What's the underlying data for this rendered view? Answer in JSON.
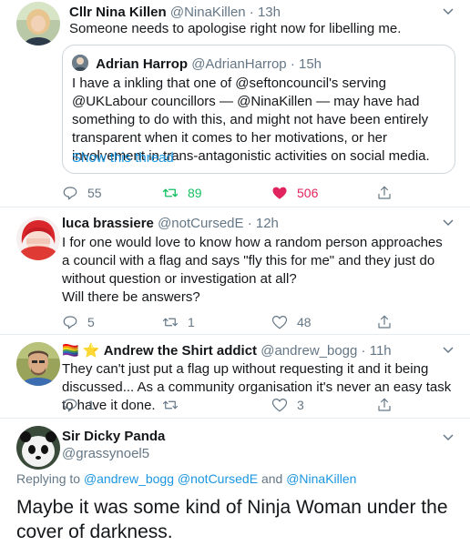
{
  "tweets": [
    {
      "name": "Cllr Nina Killen",
      "handle": "@NinaKillen",
      "time": "· 13h",
      "text": "Someone needs to apologise right now for libelling me.",
      "quote": {
        "name": "Adrian Harrop",
        "handle": "@AdrianHarrop",
        "time": "· 15h",
        "text": "I have a inkling that one of @seftoncouncil's serving @UKLabour councillors — @NinaKillen — may have had something to do with this, and might not have been entirely transparent when it comes to her motivations, or her involvement in trans-antagonistic activities on social media.",
        "show_thread": "Show this thread"
      },
      "replies": "55",
      "retweets": "89",
      "likes": "506"
    },
    {
      "name": "luca brassiere",
      "handle": "@notCursedE",
      "time": "· 12h",
      "text_1": "I for one would love to know how a random person approaches a council with a flag and says \"fly this for me\" and they just do without question or investigation at all?",
      "text_2": "Will there be answers?",
      "replies": "5",
      "retweets": "1",
      "likes": "48"
    },
    {
      "name_emoji": "🏳️‍🌈 ⭐",
      "name": "Andrew the Shirt addict",
      "handle": "@andrew_bogg",
      "time": "· 11h",
      "text": "They can't just put a flag up without requesting it and it being discussed... As a community organisation it's never an easy task to have it done.",
      "replies": "1",
      "retweets": "",
      "likes": "3"
    },
    {
      "name": "Sir Dicky Panda",
      "handle": "@grassynoel5",
      "replying_label": "Replying to",
      "replying_to_1": "@andrew_bogg",
      "replying_to_2": "@notCursedE",
      "replying_and": "and",
      "replying_to_3": "@NinaKillen",
      "text": "Maybe it was some kind of Ninja Woman under the cover of darkness."
    }
  ],
  "colors": {
    "accent": "#1b95e0",
    "retweet": "#17bf63",
    "like": "#e0245e",
    "muted": "#657786"
  }
}
